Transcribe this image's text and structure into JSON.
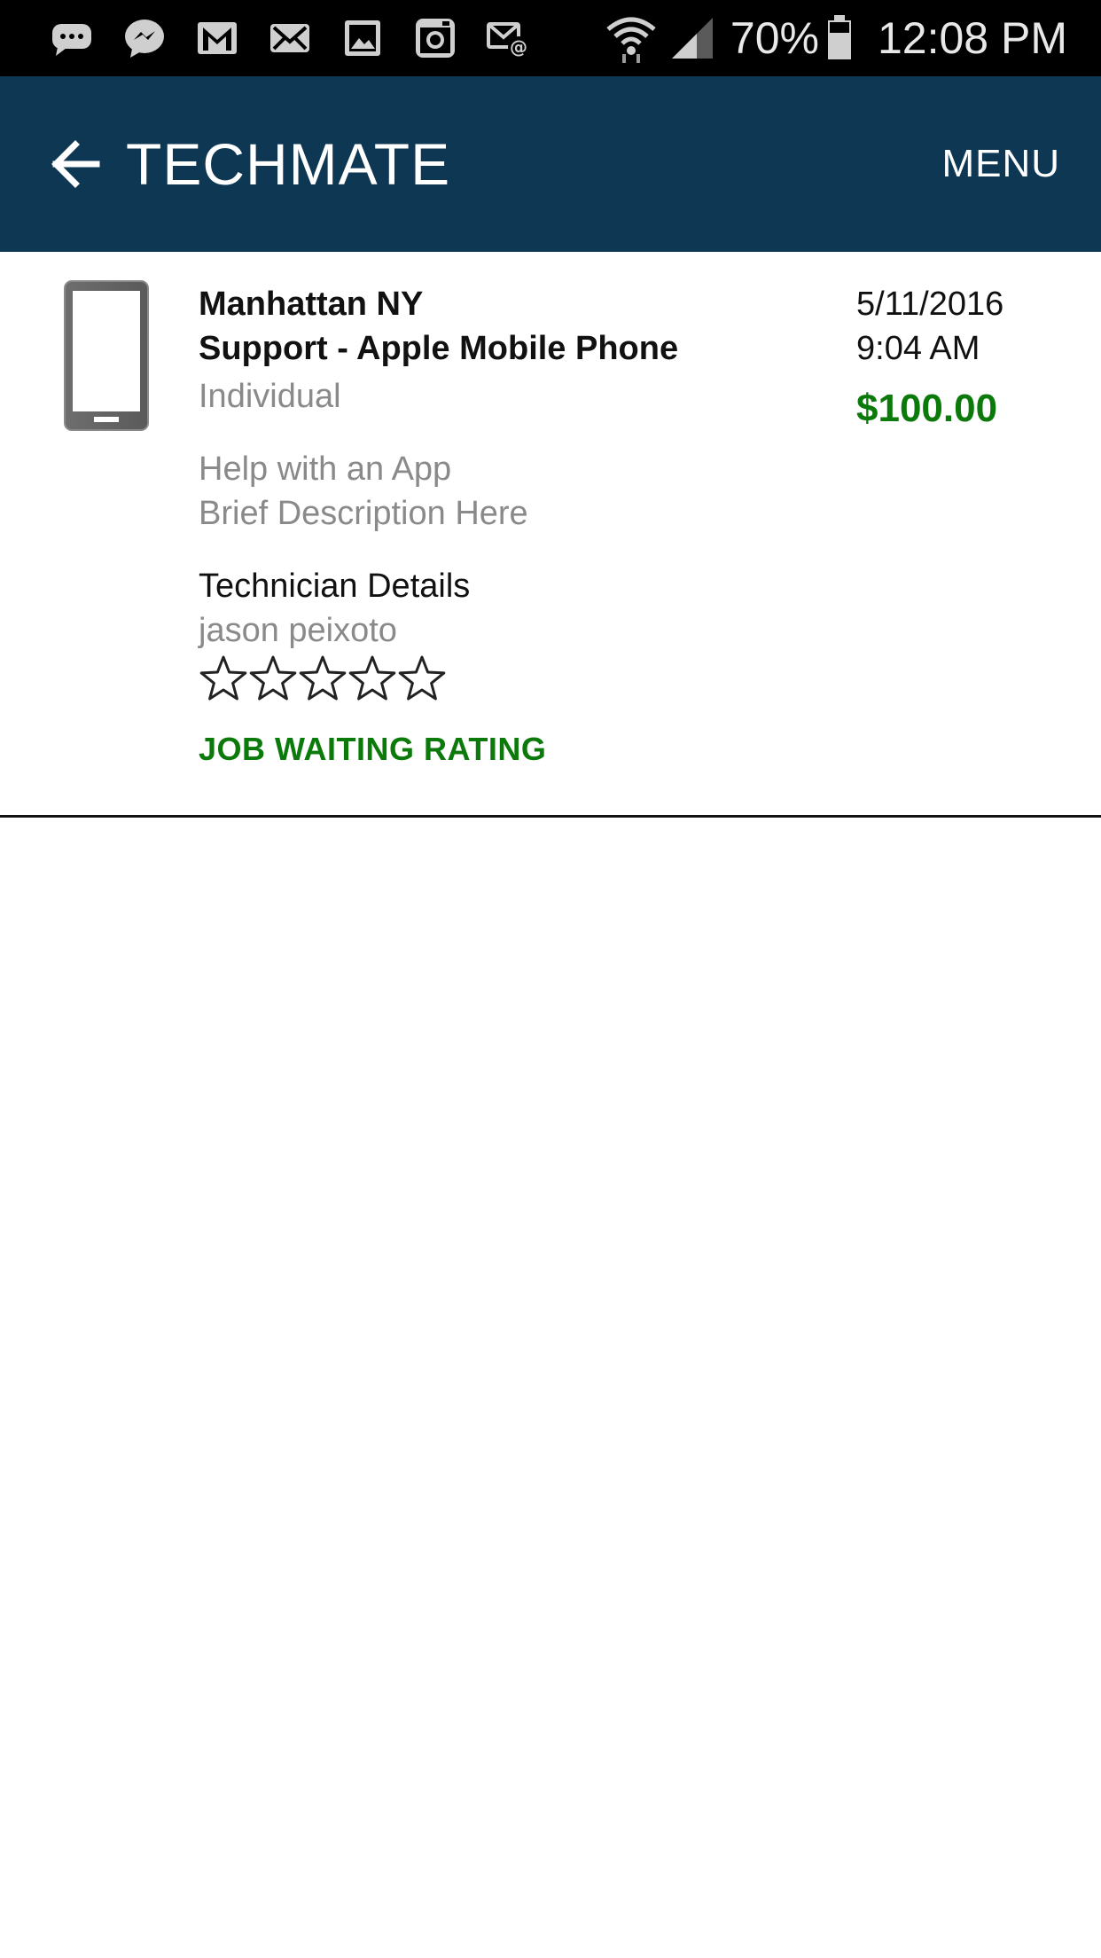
{
  "status_bar": {
    "left_icons": [
      "chat-bubble-icon",
      "messenger-icon",
      "gmail-icon",
      "email-icon",
      "gallery-icon",
      "instagram-icon",
      "email-at-icon"
    ],
    "battery_percent": "70%",
    "time": "12:08 PM"
  },
  "app_bar": {
    "title": "TECHMATE",
    "menu_label": "MENU",
    "background_color": "#0e3754"
  },
  "job": {
    "location": "Manhattan NY",
    "service": "Support - Apple Mobile Phone",
    "customer_type": "Individual",
    "issue": "Help with an App",
    "description": "Brief Description Here",
    "technician_header": "Technician Details",
    "technician_name": "jason peixoto",
    "rating_value": 0,
    "rating_max": 5,
    "status": "JOB WAITING RATING",
    "date": "5/11/2016",
    "time": "9:04 AM",
    "price": "$100.00",
    "accent_color": "#0b7a0b"
  }
}
